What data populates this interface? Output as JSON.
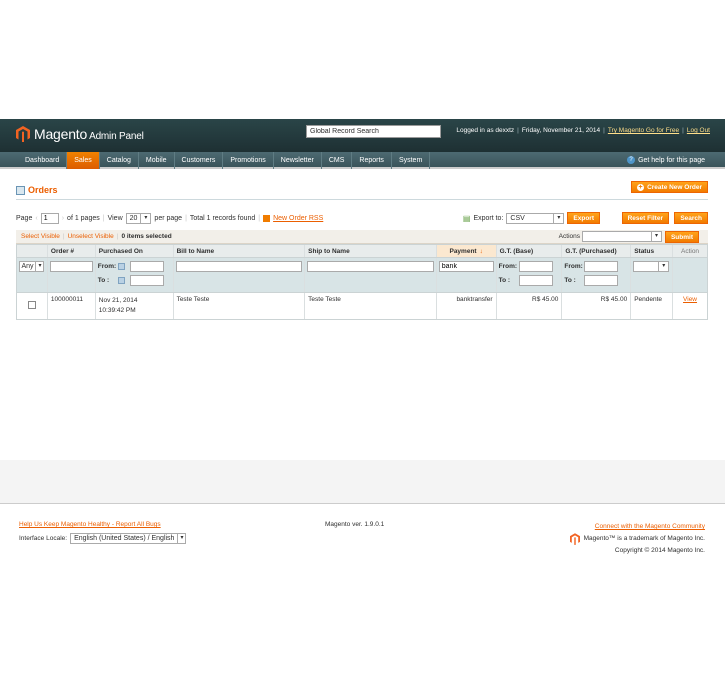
{
  "header": {
    "logo_text": "Magento",
    "logo_sub": "Admin Panel",
    "search_value": "Global Record Search",
    "logged_in": "Logged in as dexxtz",
    "date": "Friday, November 21, 2014",
    "try_link": "Try Magento Go for Free",
    "logout_link": "Log Out"
  },
  "nav": {
    "items": [
      "Dashboard",
      "Sales",
      "Catalog",
      "Mobile",
      "Customers",
      "Promotions",
      "Newsletter",
      "CMS",
      "Reports",
      "System"
    ],
    "active": "Sales",
    "help": "Get help for this page"
  },
  "page": {
    "title": "Orders",
    "create_button": "Create New Order"
  },
  "pager": {
    "page_label": "Page",
    "page_value": "1",
    "of_pages": "of 1 pages",
    "view_label": "View",
    "per_page_value": "20",
    "per_page_label": "per page",
    "total": "Total 1 records found",
    "rss_link": "New Order RSS",
    "export_label": "Export to:",
    "export_value": "CSV",
    "export_button": "Export",
    "reset_button": "Reset Filter",
    "search_button": "Search"
  },
  "massaction": {
    "select_visible": "Select Visible",
    "unselect_visible": "Unselect Visible",
    "selected": "0 items selected",
    "actions_label": "Actions",
    "submit_button": "Submit"
  },
  "grid": {
    "columns": {
      "order": "Order #",
      "purchased": "Purchased On",
      "bill": "Bill to Name",
      "ship": "Ship to Name",
      "payment": "Payment",
      "gt_base": "G.T. (Base)",
      "gt_purchased": "G.T. (Purchased)",
      "status": "Status",
      "action": "Action"
    },
    "filter": {
      "any": "Any",
      "from": "From:",
      "to": "To :",
      "payment_value": "bank"
    },
    "rows": [
      {
        "order": "100000011",
        "purchased_date": "Nov 21, 2014",
        "purchased_time": "10:39:42 PM",
        "bill": "Teste Teste",
        "ship": "Teste Teste",
        "payment": "banktransfer",
        "gt_base": "R$ 45.00",
        "gt_purchased": "R$ 45.00",
        "status": "Pendente",
        "action": "View"
      }
    ]
  },
  "footer": {
    "bug_link": "Help Us Keep Magento Healthy - Report All Bugs",
    "locale_label": "Interface Locale:",
    "locale_value": "English (United States) / English",
    "version": "Magento ver. 1.9.0.1",
    "community_link": "Connect with the Magento Community",
    "trademark": "Magento™ is a trademark of Magento Inc.",
    "copyright": "Copyright © 2014 Magento Inc."
  },
  "colors": {
    "accent": "#eb5e00",
    "header_bg": "#2a4548",
    "nav_bg": "#4d6a72"
  }
}
